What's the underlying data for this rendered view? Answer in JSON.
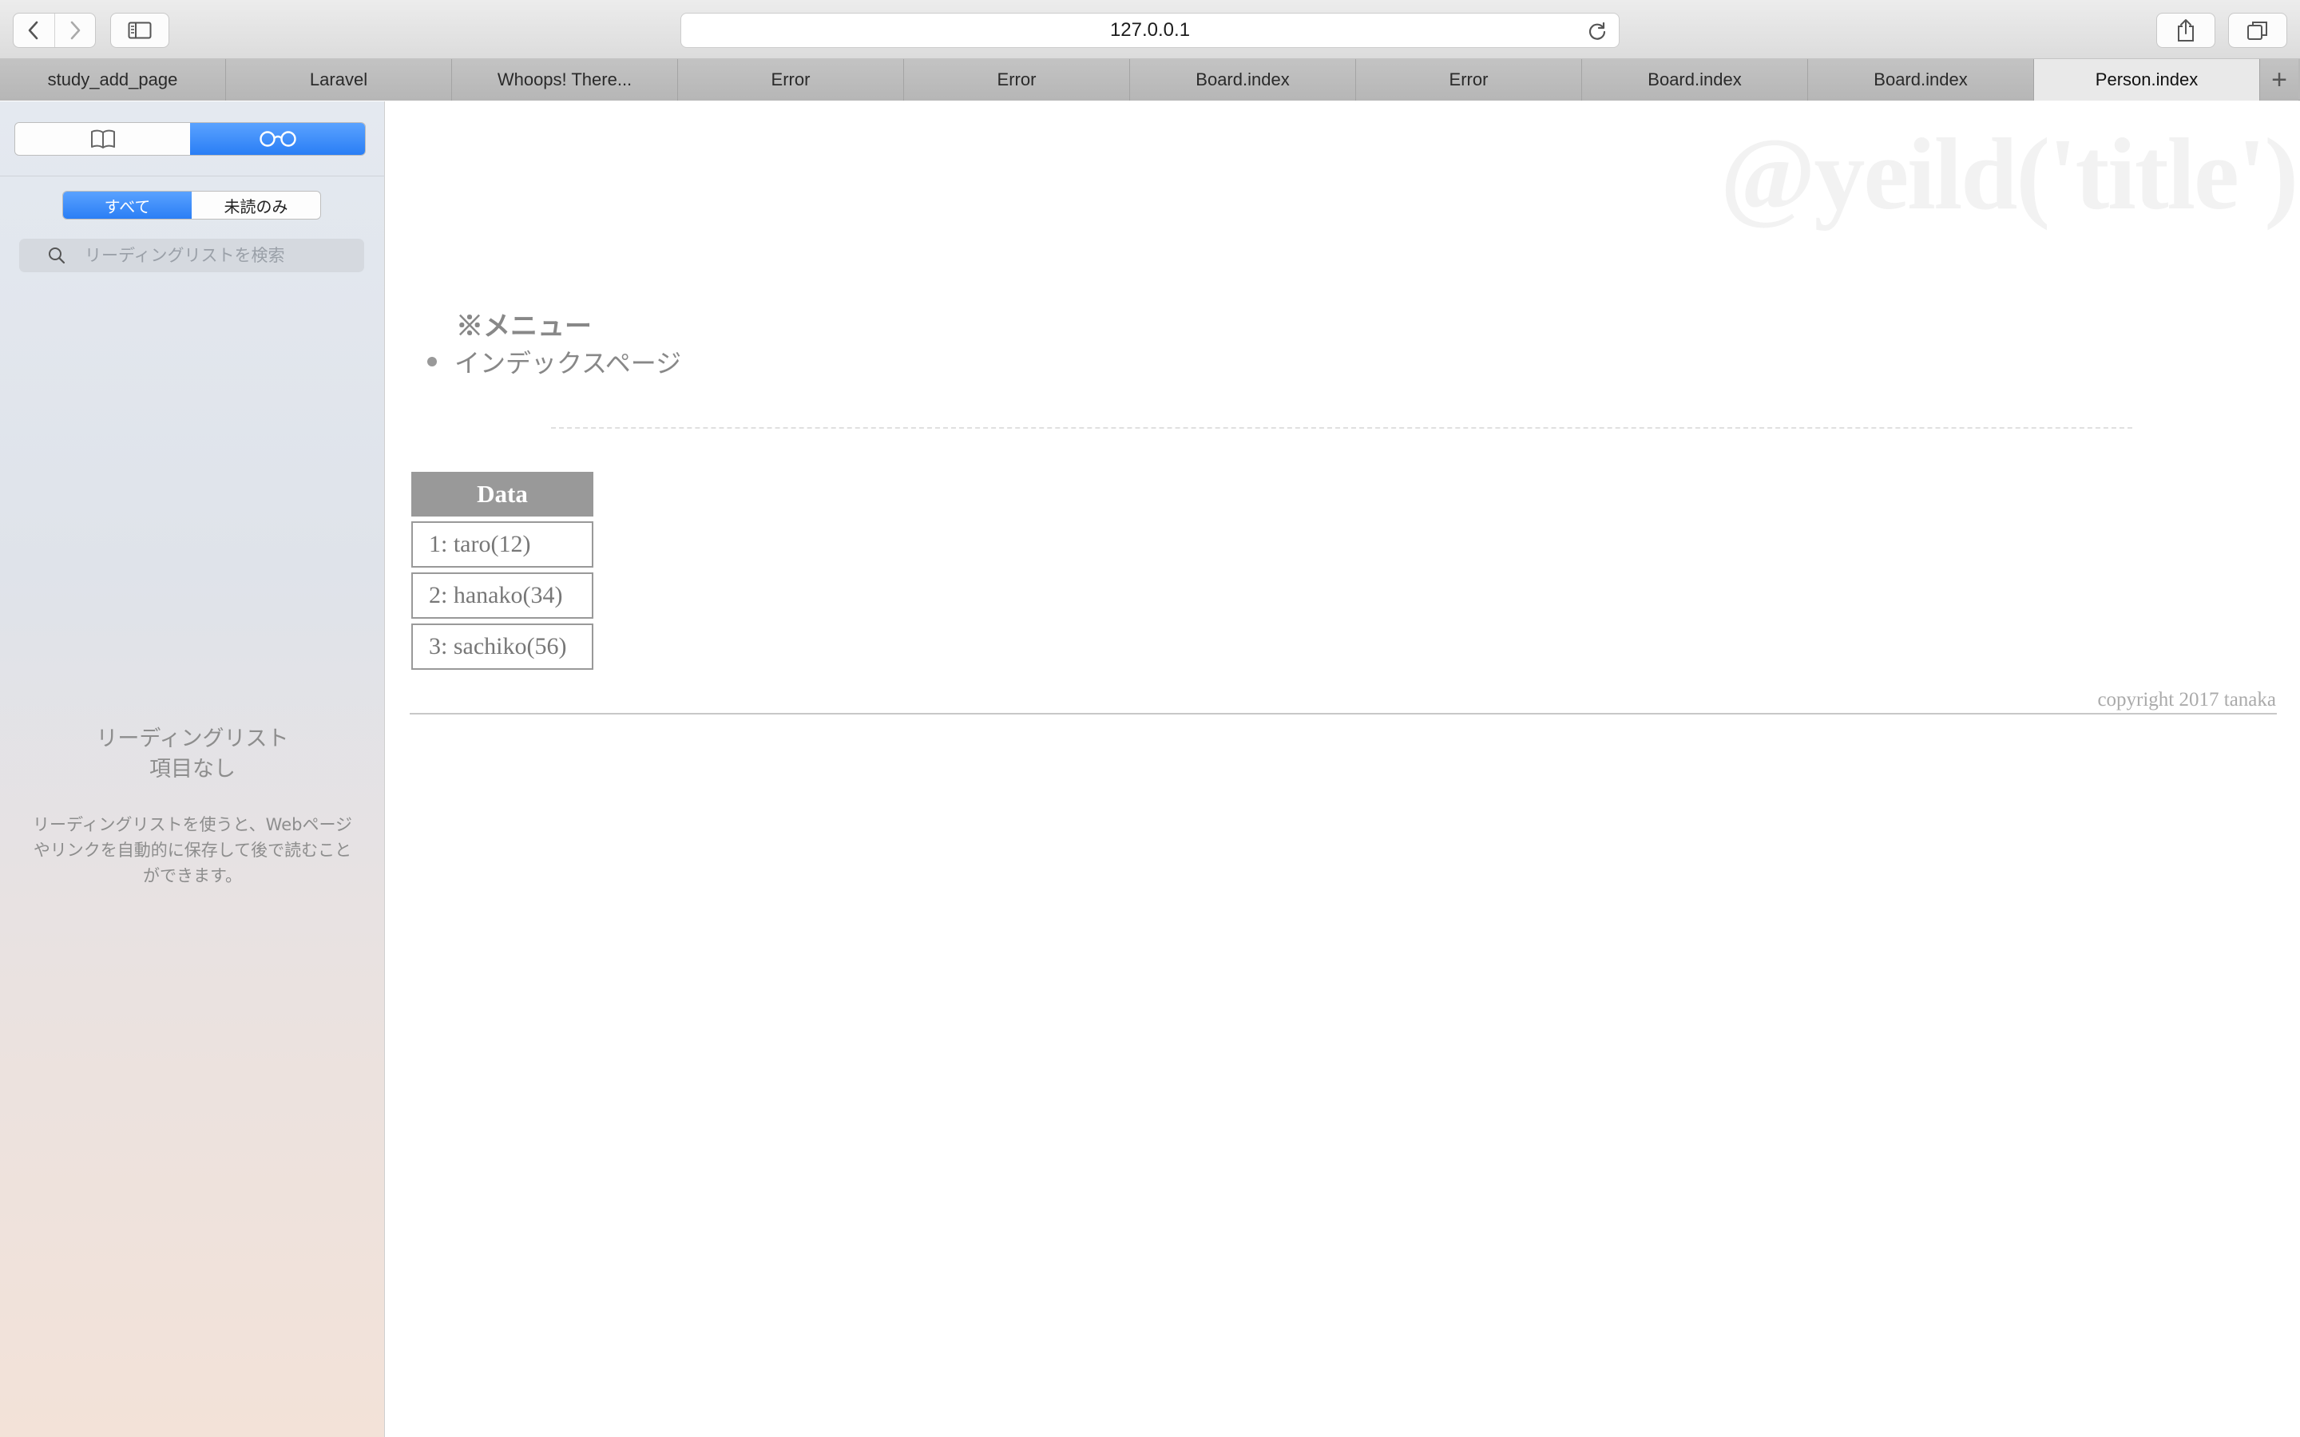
{
  "browser": {
    "address": "127.0.0.1",
    "tabs": [
      {
        "label": "study_add_page"
      },
      {
        "label": "Laravel"
      },
      {
        "label": "Whoops! There..."
      },
      {
        "label": "Error"
      },
      {
        "label": "Error"
      },
      {
        "label": "Board.index"
      },
      {
        "label": "Error"
      },
      {
        "label": "Board.index"
      },
      {
        "label": "Board.index"
      },
      {
        "label": "Person.index"
      }
    ],
    "active_tab_index": 9,
    "new_tab_label": "+"
  },
  "sidebar": {
    "mode_tabs": [
      {
        "icon": "book-icon",
        "selected": false
      },
      {
        "icon": "glasses-icon",
        "selected": true
      }
    ],
    "filter": {
      "all_label": "すべて",
      "unread_label": "未読のみ",
      "selected": "all"
    },
    "search_placeholder": "リーディングリストを検索",
    "empty_title_line1": "リーディングリスト",
    "empty_title_line2": "項目なし",
    "empty_description": "リーディングリストを使うと、Webページやリンクを自動的に保存して後で読むことができます。"
  },
  "page": {
    "title": "@yeild('title')",
    "menu_title": "※メニュー",
    "menu_items": [
      {
        "label": "インデックスページ"
      }
    ],
    "table": {
      "header": "Data",
      "rows": [
        "1: taro(12)",
        "2: hanako(34)",
        "3: sachiko(56)"
      ]
    },
    "copyright": "copyright 2017 tanaka"
  },
  "colors": {
    "accent": "#2a7ef5",
    "table_header": "#999999",
    "text_muted": "#888888"
  }
}
